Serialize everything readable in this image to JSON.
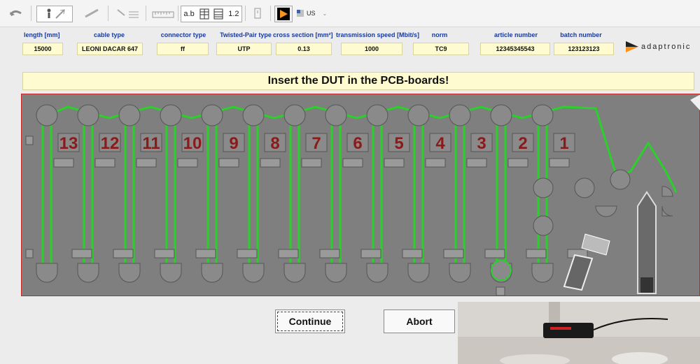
{
  "toolbar": {
    "format_label": "a.b",
    "decimal_label": "1.2",
    "locale_label": "US"
  },
  "header": {
    "fields": [
      {
        "label": "length [mm]",
        "value": "15000"
      },
      {
        "label": "cable type",
        "value": "LEONI DACAR 647"
      },
      {
        "label": "connector type",
        "value": "ff"
      },
      {
        "label": "Twisted-Pair type",
        "value": "UTP"
      },
      {
        "label": "cross section [mm²]",
        "value": "0.13"
      },
      {
        "label": "transmission speed [Mbit/s]",
        "value": "1000"
      },
      {
        "label": "norm",
        "value": "TC9"
      },
      {
        "label": "article number",
        "value": "12345345543"
      },
      {
        "label": "batch number",
        "value": "123123123"
      }
    ],
    "brand": "adaptronic",
    "brand_color": "#f7941d"
  },
  "instruction": "Insert the DUT in the PCB-boards!",
  "pcb": {
    "slot_numbers": [
      "13",
      "12",
      "11",
      "10",
      "9",
      "8",
      "7",
      "6",
      "5",
      "4",
      "3",
      "2",
      "1"
    ],
    "wire_color": "#2bd02b",
    "number_color": "#8b1a1a"
  },
  "buttons": {
    "continue": "Continue",
    "abort": "Abort"
  }
}
